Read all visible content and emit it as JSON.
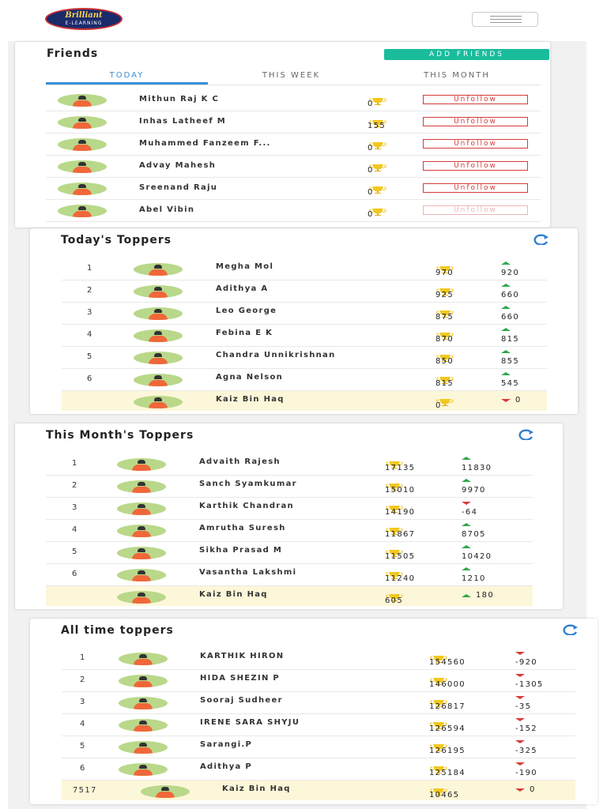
{
  "header": {
    "logo_brand": "Brilliant",
    "logo_sub": "E-LEARNING"
  },
  "friends": {
    "title": "Friends",
    "add_button": "ADD FRIENDS",
    "tabs": [
      {
        "label": "TODAY",
        "active": true
      },
      {
        "label": "THIS WEEK",
        "active": false
      },
      {
        "label": "THIS MONTH",
        "active": false
      }
    ],
    "unfollow_label": "Unfollow",
    "rows": [
      {
        "name": "Mithun Raj K C",
        "score": "0"
      },
      {
        "name": "Inhas Latheef M",
        "score": "155"
      },
      {
        "name": "Muhammed Fanzeem F...",
        "score": "0"
      },
      {
        "name": "Advay Mahesh",
        "score": "0"
      },
      {
        "name": "Sreenand Raju",
        "score": "0"
      },
      {
        "name": "Abel Vibin",
        "score": "0"
      }
    ]
  },
  "today": {
    "title": "Today's Toppers",
    "rows": [
      {
        "rank": "1",
        "name": "Megha Mol",
        "score": "970",
        "change": "920",
        "trend": "up"
      },
      {
        "rank": "2",
        "name": "Adithya A",
        "score": "925",
        "change": "660",
        "trend": "up"
      },
      {
        "rank": "3",
        "name": "Leo George",
        "score": "875",
        "change": "660",
        "trend": "up"
      },
      {
        "rank": "4",
        "name": "Febina E K",
        "score": "870",
        "change": "815",
        "trend": "up"
      },
      {
        "rank": "5",
        "name": "Chandra Unnikrishnan",
        "score": "850",
        "change": "855",
        "trend": "up"
      },
      {
        "rank": "6",
        "name": "Agna Nelson",
        "score": "815",
        "change": "545",
        "trend": "up"
      }
    ],
    "me": {
      "rank": "",
      "name": "Kaiz Bin Haq",
      "score": "0",
      "change": "0",
      "trend": "down"
    }
  },
  "month": {
    "title": "This Month's Toppers",
    "rows": [
      {
        "rank": "1",
        "name": "Advaith Rajesh",
        "score": "17135",
        "change": "11830",
        "trend": "up"
      },
      {
        "rank": "2",
        "name": "Sanch Syamkumar",
        "score": "15010",
        "change": "9970",
        "trend": "up"
      },
      {
        "rank": "3",
        "name": "Karthik Chandran",
        "score": "14190",
        "change": "-64",
        "trend": "down"
      },
      {
        "rank": "4",
        "name": "Amrutha Suresh",
        "score": "11867",
        "change": "8705",
        "trend": "up"
      },
      {
        "rank": "5",
        "name": "Sikha Prasad M",
        "score": "11505",
        "change": "10420",
        "trend": "up"
      },
      {
        "rank": "6",
        "name": "Vasantha Lakshmi",
        "score": "11240",
        "change": "1210",
        "trend": "up"
      }
    ],
    "me": {
      "rank": "",
      "name": "Kaiz Bin Haq",
      "score": "605",
      "change": "180",
      "trend": "up"
    }
  },
  "alltime": {
    "title": "All time toppers",
    "rows": [
      {
        "rank": "1",
        "name": "KARTHIK HIRON",
        "score": "154560",
        "change": "-920",
        "trend": "down"
      },
      {
        "rank": "2",
        "name": "HIDA SHEZIN P",
        "score": "146000",
        "change": "-1305",
        "trend": "down"
      },
      {
        "rank": "3",
        "name": "Sooraj Sudheer",
        "score": "126817",
        "change": "-35",
        "trend": "down"
      },
      {
        "rank": "4",
        "name": "IRENE SARA SHYJU",
        "score": "126594",
        "change": "-152",
        "trend": "down"
      },
      {
        "rank": "5",
        "name": "Sarangi.P",
        "score": "126195",
        "change": "-325",
        "trend": "down"
      },
      {
        "rank": "6",
        "name": "Adithya P",
        "score": "125184",
        "change": "-190",
        "trend": "down"
      }
    ],
    "me": {
      "rank": "7517",
      "name": "Kaiz Bin Haq",
      "score": "10465",
      "change": "0",
      "trend": "down"
    }
  },
  "colors": {
    "accent": "#1abc9c",
    "tab_active": "#3a8fd6",
    "unfollow": "#d43c3c",
    "trend_up": "#2ea84b",
    "trend_down": "#d83a3a",
    "highlight_row": "#fdf7d9"
  }
}
